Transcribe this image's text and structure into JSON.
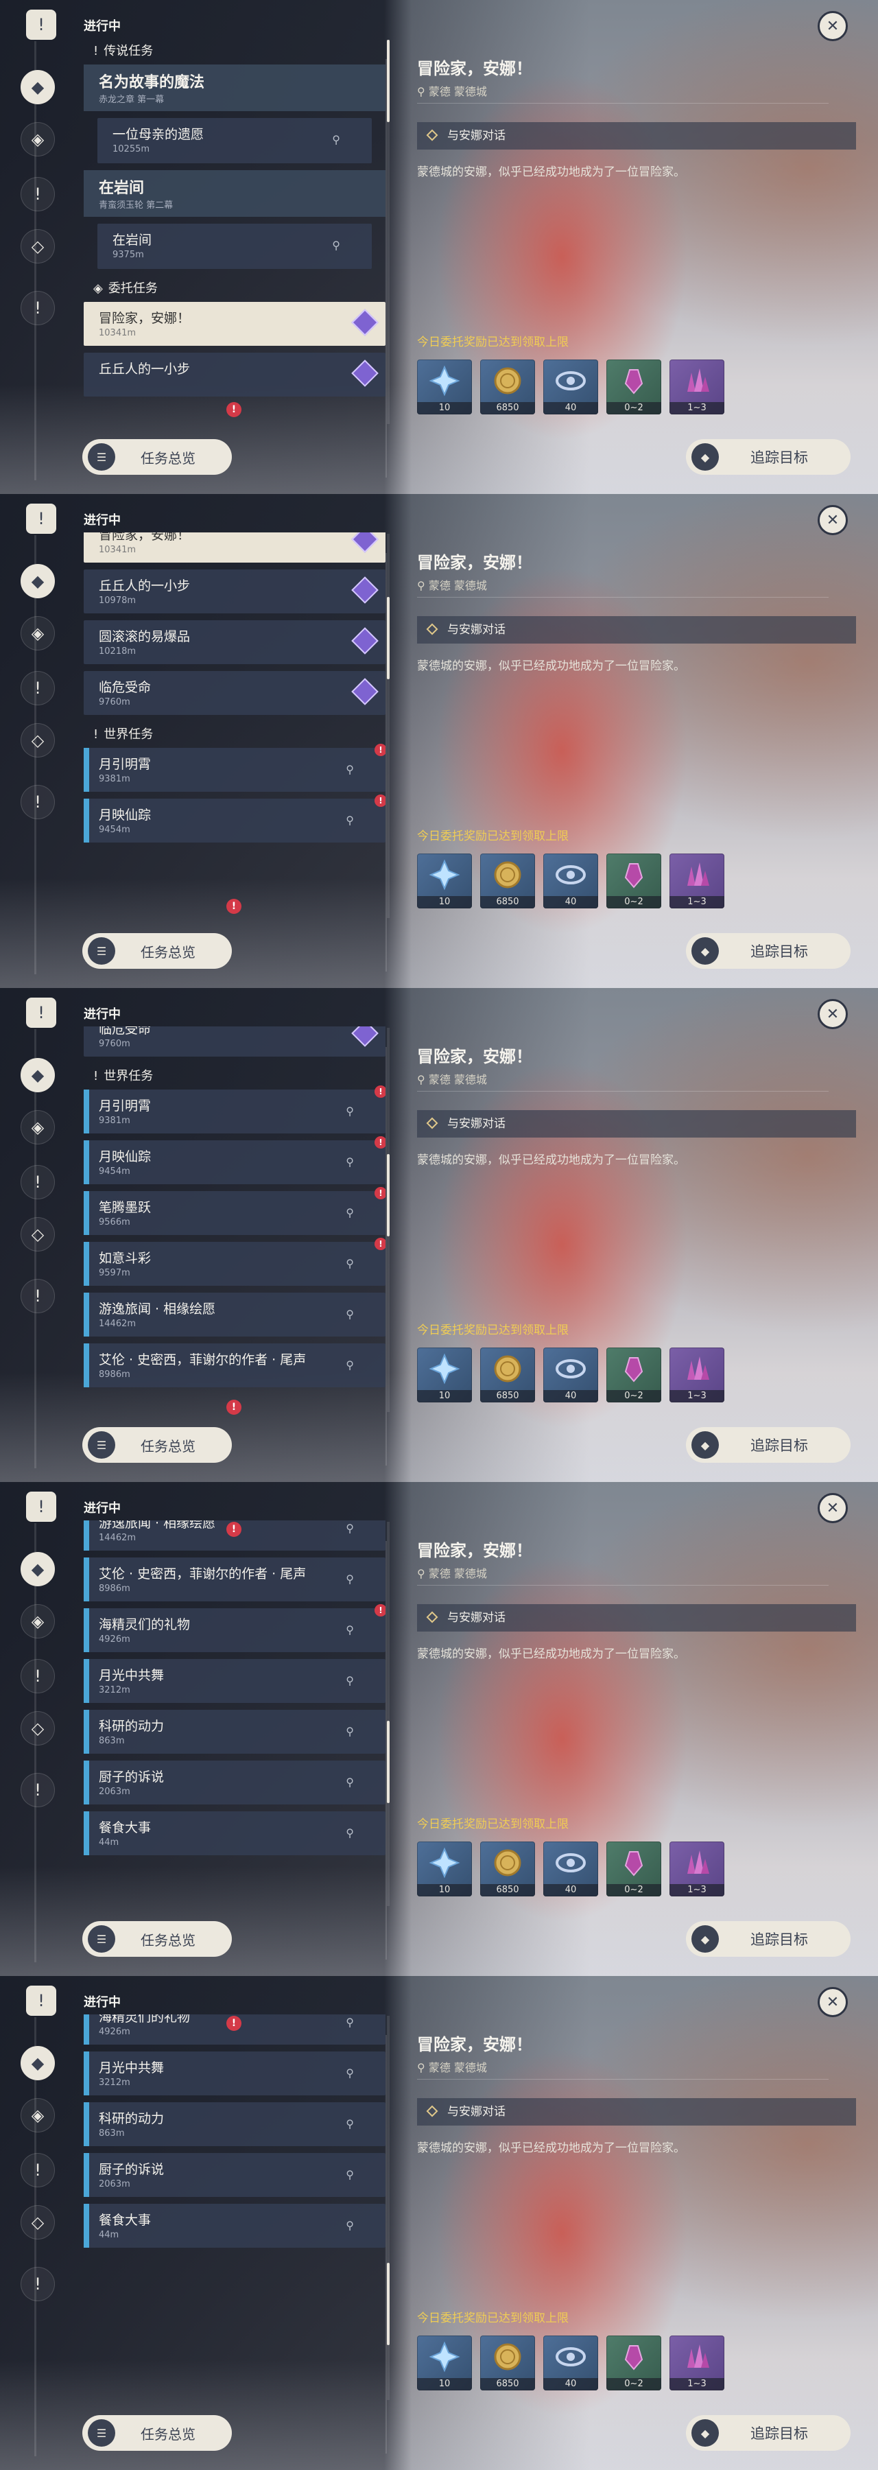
{
  "common": {
    "in_progress": "进行中",
    "overview_btn": "任务总览",
    "track_btn": "追踪目标"
  },
  "detail": {
    "title": "冒险家，安娜！",
    "location": "蒙德 蒙德城",
    "objective": "与安娜对话",
    "description": "蒙德城的安娜，似乎已经成功地成为了一位冒险家。",
    "reward_notice": "今日委托奖励已达到领取上限",
    "rewards": [
      {
        "icon": "adventure-exp-icon",
        "qty": "10",
        "tone": "blue"
      },
      {
        "icon": "mora-coin-icon",
        "qty": "6850",
        "tone": "blue"
      },
      {
        "icon": "companionship-exp-icon",
        "qty": "40",
        "tone": "blue"
      },
      {
        "icon": "crystal-ore-icon",
        "qty": "0~2",
        "tone": "green"
      },
      {
        "icon": "crystal-chunk-icon",
        "qty": "1~3",
        "tone": "purple"
      }
    ]
  },
  "panels": [
    {
      "items": [
        {
          "kind": "section",
          "icon": "!",
          "label": "传说任务"
        },
        {
          "kind": "big",
          "title": "名为故事的魔法",
          "dist": "赤龙之章 第一幕"
        },
        {
          "kind": "sub",
          "title": "一位母亲的遗愿",
          "dist": "10255m"
        },
        {
          "kind": "big",
          "title": "在岩间",
          "dist": "青蛮须玉轮 第二幕"
        },
        {
          "kind": "sub",
          "title": "在岩间",
          "dist": "9375m"
        },
        {
          "kind": "section",
          "icon": "◈",
          "label": "委托任务"
        },
        {
          "kind": "commission",
          "title": "冒险家，安娜！",
          "dist": "10341m",
          "selected": true
        },
        {
          "kind": "commission",
          "title": "丘丘人的一小步",
          "dist": ""
        }
      ]
    },
    {
      "items": [
        {
          "kind": "commission",
          "title": "冒险家，安娜！",
          "dist": "10341m",
          "selected": true
        },
        {
          "kind": "commission",
          "title": "丘丘人的一小步",
          "dist": "10978m"
        },
        {
          "kind": "commission",
          "title": "圆滚滚的易爆品",
          "dist": "10218m"
        },
        {
          "kind": "commission",
          "title": "临危受命",
          "dist": "9760m"
        },
        {
          "kind": "section",
          "icon": "!",
          "label": "世界任务"
        },
        {
          "kind": "world",
          "title": "月引明霄",
          "dist": "9381m",
          "badge": true
        },
        {
          "kind": "world",
          "title": "月映仙踪",
          "dist": "9454m",
          "badge": true
        }
      ]
    },
    {
      "items": [
        {
          "kind": "commission",
          "title": "临危受命",
          "dist": "9760m"
        },
        {
          "kind": "section",
          "icon": "!",
          "label": "世界任务"
        },
        {
          "kind": "world",
          "title": "月引明霄",
          "dist": "9381m",
          "badge": true
        },
        {
          "kind": "world",
          "title": "月映仙踪",
          "dist": "9454m",
          "badge": true
        },
        {
          "kind": "world",
          "title": "笔腾墨跃",
          "dist": "9566m",
          "badge": true
        },
        {
          "kind": "world",
          "title": "如意斗彩",
          "dist": "9597m",
          "badge": true
        },
        {
          "kind": "world",
          "title": "游逸旅闻 · 相缘绘愿",
          "dist": "14462m"
        },
        {
          "kind": "world",
          "title": "艾伦 · 史密西，菲谢尔的作者 · 尾声",
          "dist": "8986m"
        }
      ]
    },
    {
      "items": [
        {
          "kind": "world",
          "title": "游逸旅闻 · 相缘绘愿",
          "dist": "14462m"
        },
        {
          "kind": "world",
          "title": "艾伦 · 史密西，菲谢尔的作者 · 尾声",
          "dist": "8986m"
        },
        {
          "kind": "world",
          "title": "海精灵们的礼物",
          "dist": "4926m",
          "badge": true
        },
        {
          "kind": "world",
          "title": "月光中共舞",
          "dist": "3212m"
        },
        {
          "kind": "world",
          "title": "科研的动力",
          "dist": "863m"
        },
        {
          "kind": "world",
          "title": "厨子的诉说",
          "dist": "2063m"
        },
        {
          "kind": "world",
          "title": "餐食大事",
          "dist": "44m"
        }
      ]
    },
    {
      "items": [
        {
          "kind": "world",
          "title": "海精灵们的礼物",
          "dist": "4926m",
          "badge": true
        },
        {
          "kind": "world",
          "title": "月光中共舞",
          "dist": "3212m"
        },
        {
          "kind": "world",
          "title": "科研的动力",
          "dist": "863m"
        },
        {
          "kind": "world",
          "title": "厨子的诉说",
          "dist": "2063m"
        },
        {
          "kind": "world",
          "title": "餐食大事",
          "dist": "44m"
        }
      ]
    }
  ]
}
